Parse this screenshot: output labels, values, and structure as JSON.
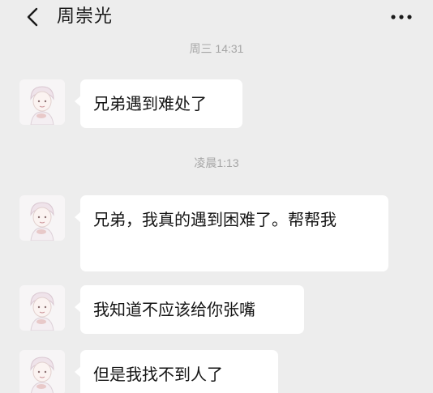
{
  "header": {
    "title": "周崇光",
    "back_icon": "chevron-left-icon",
    "more_icon": "more-dots-icon"
  },
  "timestamps": [
    "周三 14:31",
    "凌晨1:13"
  ],
  "messages": [
    {
      "text": "兄弟遇到难处了"
    },
    {
      "text": "兄弟，我真的遇到困难了。帮帮我"
    },
    {
      "text": "我知道不应该给你张嘴"
    },
    {
      "text": "但是我找不到人了"
    }
  ],
  "colors": {
    "background": "#ededed",
    "bubble": "#ffffff",
    "timestamp": "#a6a6a6"
  }
}
